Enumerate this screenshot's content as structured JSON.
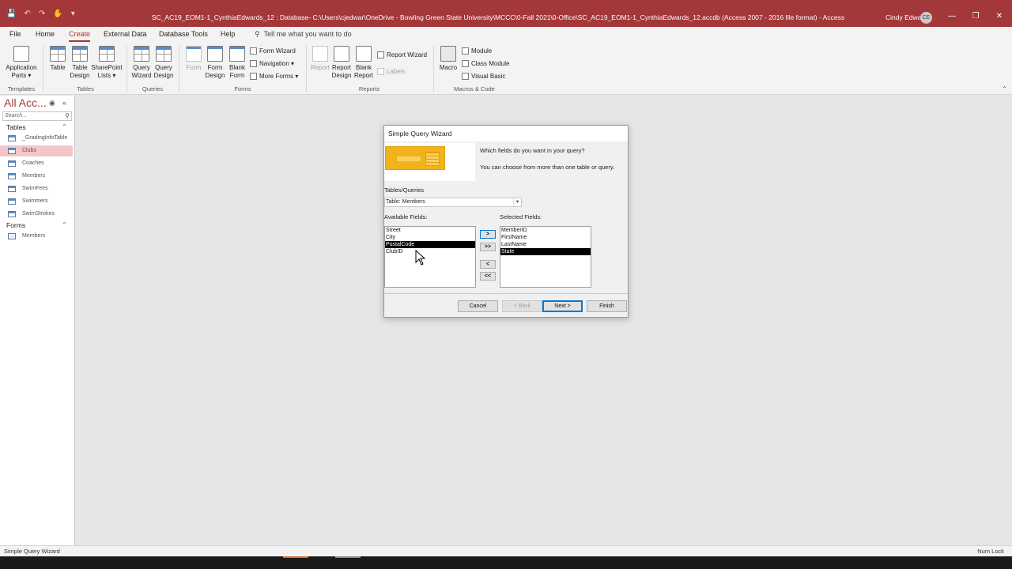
{
  "window": {
    "title": "SC_AC19_EOM1-1_CynthiaEdwards_12 : Database- C:\\Users\\cjedwar\\OneDrive - Bowling Green State University\\MCCC\\0-Fall 2021\\0-Office\\SC_AC19_EOM1-1_CynthiaEdwards_12.accdb (Access 2007 - 2016 file format)  -  Access",
    "user": "Cindy Edwards",
    "avatar_initials": "CE",
    "accent_color": "#a4373a"
  },
  "tabs": [
    "File",
    "Home",
    "Create",
    "External Data",
    "Database Tools",
    "Help"
  ],
  "active_tab": "Create",
  "tell_me": "Tell me what you want to do",
  "ribbon": {
    "templates": {
      "label": "Templates",
      "app_parts": "Application",
      "app_parts2": "Parts ▾"
    },
    "tables": {
      "label": "Tables",
      "table": "Table",
      "table_design": "Table",
      "table_design2": "Design",
      "sharepoint": "SharePoint",
      "sharepoint2": "Lists ▾"
    },
    "queries": {
      "label": "Queries",
      "query_wizard": "Query",
      "query_wizard2": "Wizard",
      "query_design": "Query",
      "query_design2": "Design"
    },
    "forms": {
      "label": "Forms",
      "form": "Form",
      "form_design": "Form",
      "form_design2": "Design",
      "blank_form": "Blank",
      "blank_form2": "Form",
      "form_wizard": "Form Wizard",
      "navigation": "Navigation ▾",
      "more_forms": "More Forms ▾"
    },
    "reports": {
      "label": "Reports",
      "report": "Report",
      "report_design": "Report",
      "report_design2": "Design",
      "blank_report": "Blank",
      "blank_report2": "Report",
      "report_wizard": "Report Wizard",
      "labels": "Labels"
    },
    "macros": {
      "label": "Macros & Code",
      "macro": "Macro",
      "module": "Module",
      "class_module": "Class Module",
      "visual_basic": "Visual Basic"
    }
  },
  "nav": {
    "title": "All Acc...",
    "search_placeholder": "Search...",
    "tables_header": "Tables",
    "tables": [
      "_GradingInfoTable",
      "Clubs",
      "Coaches",
      "Members",
      "SwimFees",
      "Swimmers",
      "SwimStrokes"
    ],
    "selected_table": "Clubs",
    "forms_header": "Forms",
    "forms": [
      "Members"
    ]
  },
  "dialog": {
    "title": "Simple Query Wizard",
    "prompt1": "Which fields do you want in your query?",
    "prompt2": "You can choose from more than one table or query.",
    "tables_queries_label": "Tables/Queries",
    "selected_table": "Table: Members",
    "available_label": "Available Fields:",
    "selected_label": "Selected Fields:",
    "available_fields": [
      "Street",
      "City",
      "PostalCode",
      "ClubID"
    ],
    "available_selected": "PostalCode",
    "selected_fields": [
      "MemberID",
      "FirstName",
      "LastName",
      "State"
    ],
    "selected_selected": "State",
    "move_one": ">",
    "move_all": ">>",
    "remove_one": "<",
    "remove_all": "<<",
    "cancel": "Cancel",
    "back": "< Back",
    "next": "Next >",
    "finish": "Finish"
  },
  "status": {
    "left": "Simple Query Wizard",
    "right": "Num Lock"
  }
}
